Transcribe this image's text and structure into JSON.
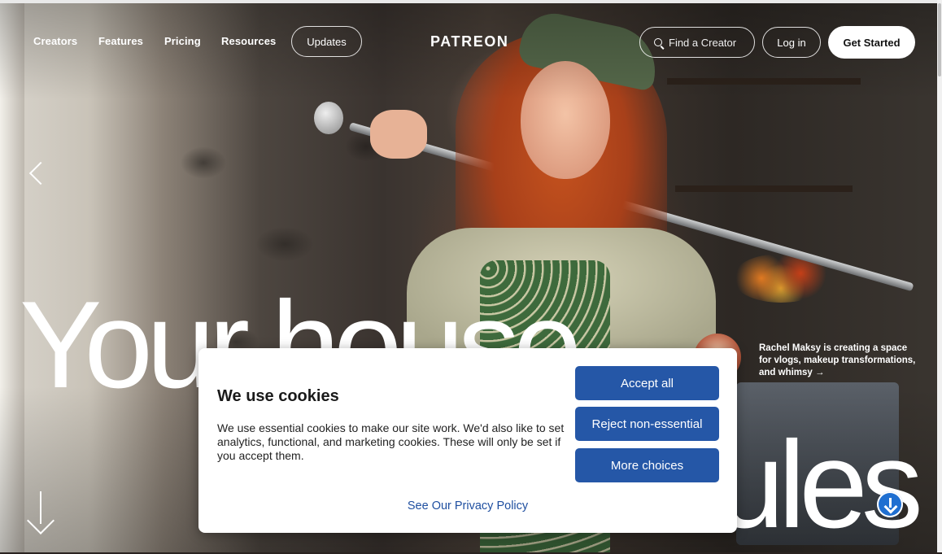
{
  "nav": {
    "links": [
      "Creators",
      "Features",
      "Pricing",
      "Resources"
    ],
    "updates_label": "Updates",
    "logo": "PATREON",
    "search_label": "Find a Creator",
    "login_label": "Log in",
    "get_started_label": "Get Started"
  },
  "hero": {
    "headline_part1": "Your house",
    "headline_part2": "ules",
    "creator_caption": "Rachel Maksy is creating a space for vlogs, makeup transformations, and whimsy →"
  },
  "cookie": {
    "title": "We use cookies",
    "body": "We use essential cookies to make our site work. We'd also like to set analytics, functional, and marketing cookies. These will only be set if you accept them.",
    "accept_label": "Accept all",
    "reject_label": "Reject non-essential",
    "more_label": "More choices",
    "privacy_label": "See Our Privacy Policy"
  },
  "colors": {
    "cookie_button": "#2557a7",
    "privacy_link": "#1f4fa0"
  }
}
